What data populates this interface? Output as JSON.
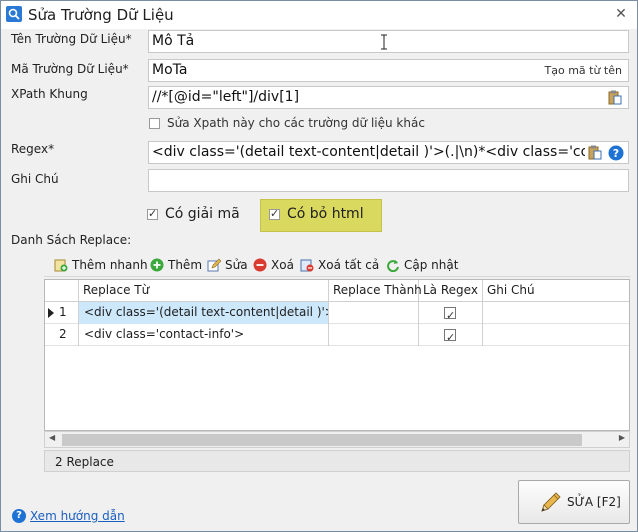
{
  "window": {
    "title": "Sửa Trường Dữ Liệu",
    "close": "✕"
  },
  "form": {
    "ten_truong": {
      "label": "Tên Trường Dữ Liệu*",
      "value": "Mô Tả"
    },
    "ma_truong": {
      "label": "Mã Trường Dữ Liệu*",
      "value": "MoTa",
      "generate_label": "Tạo mã từ tên"
    },
    "xpath": {
      "label": "XPath Khung",
      "value": "//*[@id=\"left\"]/div[1]"
    },
    "xpath_option": {
      "label": "Sửa Xpath này cho các trường dữ liệu khác",
      "checked": false
    },
    "regex": {
      "label": "Regex*",
      "value": "<div class='(detail text-content|detail )'>(.|\\n)*<div class='conta"
    },
    "ghi_chu": {
      "label": "Ghi Chú",
      "value": ""
    },
    "co_giai_ma": {
      "label": "Có giải mã",
      "checked": true
    },
    "co_bo_html": {
      "label": "Có bỏ html",
      "checked": true
    }
  },
  "replace_list": {
    "label": "Danh Sách Replace:",
    "toolbar": {
      "them_nhanh": "Thêm nhanh",
      "them": "Thêm",
      "sua": "Sửa",
      "xoa": "Xoá",
      "xoa_tat_ca": "Xoá tất cả",
      "cap_nhat": "Cập nhật"
    },
    "columns": [
      "Replace Từ",
      "Replace Thành",
      "Là Regex",
      "Ghi Chú"
    ],
    "rows": [
      {
        "index": "1",
        "tu": "<div class='(detail text-content|detail )'>",
        "thanh": "",
        "regex": true,
        "ghi_chu": ""
      },
      {
        "index": "2",
        "tu": "<div class='contact-info'>",
        "thanh": "",
        "regex": true,
        "ghi_chu": ""
      }
    ],
    "status": "2 Replace"
  },
  "footer": {
    "help_link": "Xem hướng dẫn",
    "save_button": "SỬA [F2]"
  }
}
